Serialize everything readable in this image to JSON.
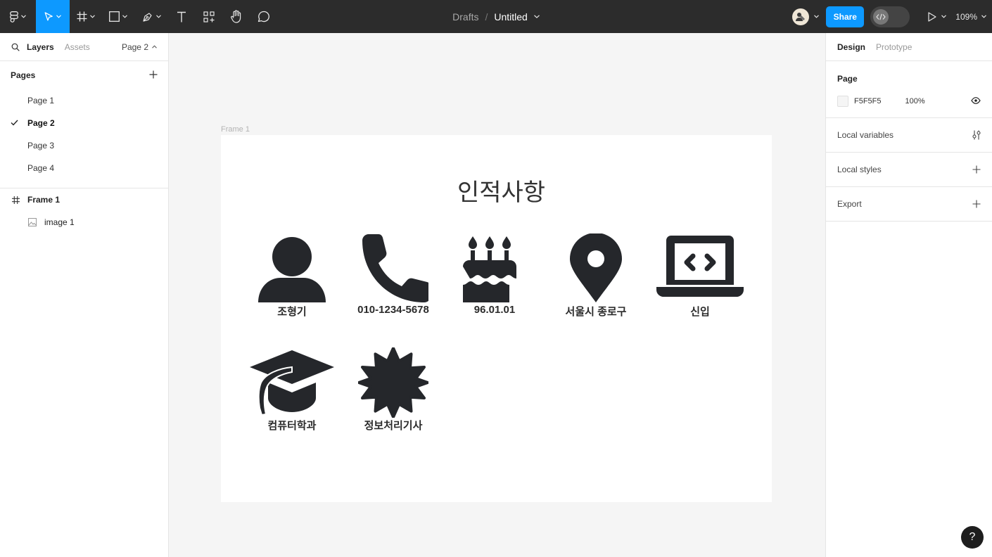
{
  "toolbar": {
    "breadcrumb_drafts": "Drafts",
    "breadcrumb_separator": "/",
    "file_title": "Untitled",
    "share_label": "Share",
    "zoom": "109%"
  },
  "left_panel": {
    "tab_layers": "Layers",
    "tab_assets": "Assets",
    "page_selector": "Page 2",
    "pages_heading": "Pages",
    "pages": [
      {
        "label": "Page 1"
      },
      {
        "label": "Page 2"
      },
      {
        "label": "Page 3"
      },
      {
        "label": "Page 4"
      }
    ],
    "current_page_index": 1,
    "layers": [
      {
        "label": "Frame 1",
        "icon": "frame-icon"
      },
      {
        "label": "image 1",
        "icon": "image-icon"
      }
    ]
  },
  "canvas": {
    "frame_label": "Frame 1",
    "title": "인적사항",
    "items": [
      {
        "label": "조형기",
        "icon": "person-icon"
      },
      {
        "label": "010-1234-5678",
        "icon": "phone-icon"
      },
      {
        "label": "96.01.01",
        "icon": "birthday-cake-icon"
      },
      {
        "label": "서울시 종로구",
        "icon": "location-pin-icon"
      },
      {
        "label": "신입",
        "icon": "laptop-code-icon"
      },
      {
        "label": "컴퓨터학과",
        "icon": "graduation-cap-icon"
      },
      {
        "label": "정보처리기사",
        "icon": "certificate-badge-icon"
      }
    ]
  },
  "right_panel": {
    "tab_design": "Design",
    "tab_prototype": "Prototype",
    "page_section_title": "Page",
    "page_fill_hex": "F5F5F5",
    "page_fill_opacity": "100%",
    "local_variables": "Local variables",
    "local_styles": "Local styles",
    "export": "Export"
  },
  "help_label": "?",
  "colors": {
    "toolbar_bg": "#2c2c2c",
    "accent": "#0d99ff",
    "canvas_bg": "#f5f5f5",
    "icon_fill": "#25272b"
  }
}
